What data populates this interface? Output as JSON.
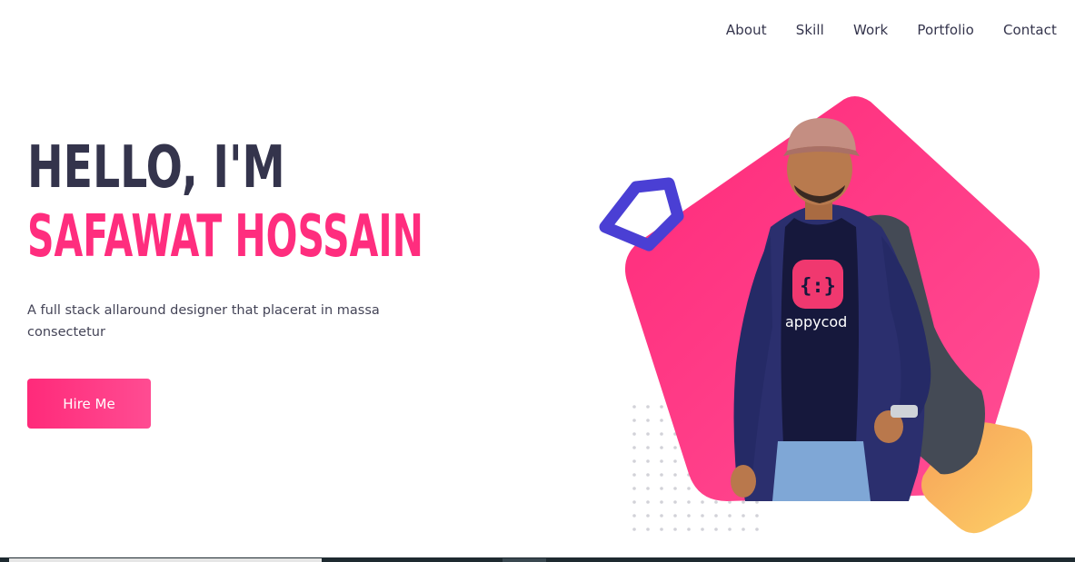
{
  "nav": {
    "items": [
      {
        "label": "About"
      },
      {
        "label": "Skill"
      },
      {
        "label": "Work"
      },
      {
        "label": "Portfolio"
      },
      {
        "label": "Contact"
      }
    ]
  },
  "hero": {
    "greeting": "HELLO, I'M",
    "name": "SAFAWAT HOSSAIN",
    "tagline": "A full stack allaround designer that placerat in massa consectetur",
    "cta_label": "Hire Me",
    "shirt_text": "appycod"
  },
  "colors": {
    "accent": "#ff2d7e",
    "heading": "#34344c",
    "hexagon_outline": "#4a3fd4",
    "yellow_shape": "#fcc35e"
  }
}
